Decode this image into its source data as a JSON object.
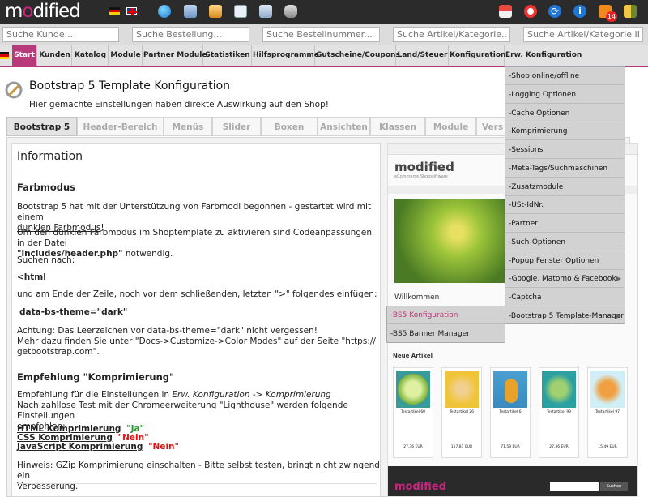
{
  "header": {
    "logo_pre": "m",
    "logo_o": "o",
    "logo_post": "dified",
    "notif_count": "14"
  },
  "search": {
    "customers": "Suche Kunde...",
    "orders": "Suche Bestellung...",
    "order_numbers": "Suche Bestellnummer...",
    "articles": "Suche Artikel/Kategorie...",
    "article_ids": "Suche Artikel/Kategorie ID..."
  },
  "nav": [
    "Start",
    "Kunden",
    "Katalog",
    "Module",
    "Partner Module",
    "Statistiken",
    "Hilfsprogramme",
    "Gutscheine/Coupons",
    "Land/Steuer",
    "Konfiguration",
    "Erw. Konfiguration"
  ],
  "page": {
    "title": "Bootstrap 5 Template Konfiguration",
    "subtitle": "Hier gemachte Einstellungen haben direkte Auswirkung auf den Shop!"
  },
  "tabs": [
    "Bootstrap 5",
    "Header-Bereich",
    "Menüs",
    "Slider",
    "Boxen",
    "Ansichten",
    "Klassen",
    "Module",
    "Vers"
  ],
  "info": {
    "heading": "Information",
    "farbmodus_title": "Farbmodus",
    "p1": "Bootstrap 5 hat mit der Unterstützung von Farbmodi begonnen - gestartet wird mit einem",
    "p1_link": "dunklen Farbmodus",
    "p1_end": "!",
    "p2": "Um den dunklen Farbmodus im Shoptemplate zu aktivieren sind Codeanpassungen in der Datei",
    "p2_file": "\"includes/header.php\"",
    "p2_end": " notwendig.",
    "p3": "Suchen nach:",
    "code1": "<html",
    "p4": "und am Ende der Zeile, noch vor dem schließenden, letzten \">\" folgendes einfügen:",
    "code2": "data-bs-theme=\"dark\"",
    "p5": "Achtung: Das Leerzeichen vor data-bs-theme=\"dark\" nicht vergessen!",
    "p6": "Mehr dazu finden Sie unter \"Docs->Customize->Color Modes\" auf der Seite \"https://",
    "p6b": "getbootstrap.com\".",
    "empf_title": "Empfehlung \"Komprimierung\"",
    "p7a": "Empfehlung für die Einstellungen in ",
    "p7b": "Erw. Konfiguration -> Komprimierung",
    "p8": "Nach zahllose Test mit der Chromeerweiterung \"Lighthouse\" werden folgende Einstellungen",
    "p8b": "empfohlen:",
    "html_k": "HTML Komprimierung",
    "html_v": "\"Ja\"",
    "css_k": "CSS Komprimierung",
    "css_v": "\"Nein\"",
    "js_k": "JavaScript Komprimierung",
    "js_v": "\"Nein\"",
    "hint_a": "Hinweis: ",
    "hint_link": "GZip Komprimierung einschalten",
    "hint_b": " - Bitte selbst testen, bringt nicht zwingend ein",
    "hint_c": "Verbesserung."
  },
  "shop": {
    "logo": "modified",
    "tagline": "eCommerce Shopsoftware",
    "welcome": "Willkommen",
    "new_articles": "Neue Artikel",
    "products": [
      {
        "name": "Testartikel 60",
        "price": "27,36 EUR"
      },
      {
        "name": "Testartikel 26",
        "price": "117,81 EUR"
      },
      {
        "name": "Testartikel 6",
        "price": "71,59 EUR"
      },
      {
        "name": "Testartikel 99",
        "price": "27,36 EUR"
      },
      {
        "name": "Testartikel 97",
        "price": "15,49 EUR"
      }
    ],
    "footer_search": "Suchen"
  },
  "dropdown": [
    "-Shop online/offline",
    "-Logging Optionen",
    "-Cache Optionen",
    "-Komprimierung",
    "-Sessions",
    "-Meta-Tags/Suchmaschinen",
    "-Zusatzmodule",
    "-USt-IdNr.",
    "-Partner",
    "-Such-Optionen",
    "-Popup Fenster Optionen",
    "-Google, Matomo & Facebook",
    "-Captcha",
    "-Bootstrap 5 Template-Manager"
  ],
  "submenu": [
    "-BS5 Konfiguration",
    "-BS5 Banner Manager"
  ],
  "colors": {
    "accent": "#b83a7a",
    "topbar": "#2b2b2b"
  }
}
